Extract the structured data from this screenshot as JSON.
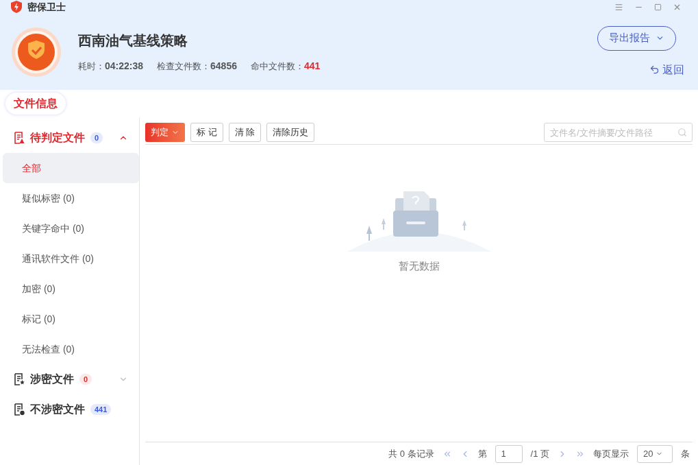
{
  "app": {
    "title": "密保卫士"
  },
  "task": {
    "title": "西南油气基线策略",
    "stats": [
      {
        "label": "耗时：",
        "value": "04:22:38",
        "highlight": false
      },
      {
        "label": "检查文件数：",
        "value": "64856",
        "highlight": false
      },
      {
        "label": "命中文件数：",
        "value": "441",
        "highlight": true
      }
    ]
  },
  "actions": {
    "export": "导出报告",
    "back": "返回"
  },
  "tabs": [
    {
      "label": "文件信息",
      "selected": true
    }
  ],
  "sidebar": {
    "groups": [
      {
        "label": "待判定文件",
        "count": "0",
        "kind": "pending",
        "expanded": true,
        "selected": true,
        "children": [
          {
            "label": "全部",
            "selected": true
          },
          {
            "label": "疑似标密 (0)",
            "selected": false
          },
          {
            "label": "关键字命中 (0)",
            "selected": false
          },
          {
            "label": "通讯软件文件 (0)",
            "selected": false
          },
          {
            "label": "加密 (0)",
            "selected": false
          },
          {
            "label": "标记 (0)",
            "selected": false
          },
          {
            "label": "无法检查 (0)",
            "selected": false
          }
        ]
      },
      {
        "label": "涉密文件",
        "count": "0",
        "kind": "secret",
        "expanded": false,
        "selected": false
      },
      {
        "label": "不涉密文件",
        "count": "441",
        "kind": "clean",
        "selected": false
      }
    ]
  },
  "toolbar": {
    "buttons": [
      {
        "label": "判定",
        "kind": "primary"
      },
      {
        "label": "标 记",
        "kind": "plain"
      },
      {
        "label": "清 除",
        "kind": "plain"
      },
      {
        "label": "清除历史",
        "kind": "plain"
      }
    ],
    "search": {
      "placeholder": "文件名/文件摘要/文件路径"
    }
  },
  "empty": {
    "text": "暂无数据"
  },
  "pagination": {
    "total": "共 0 条记录",
    "page_prefix": "第",
    "page": "1",
    "page_suffix": "/1 页",
    "per_page_label": "每页显示",
    "per_page": "20",
    "per_page_suffix": "条"
  }
}
